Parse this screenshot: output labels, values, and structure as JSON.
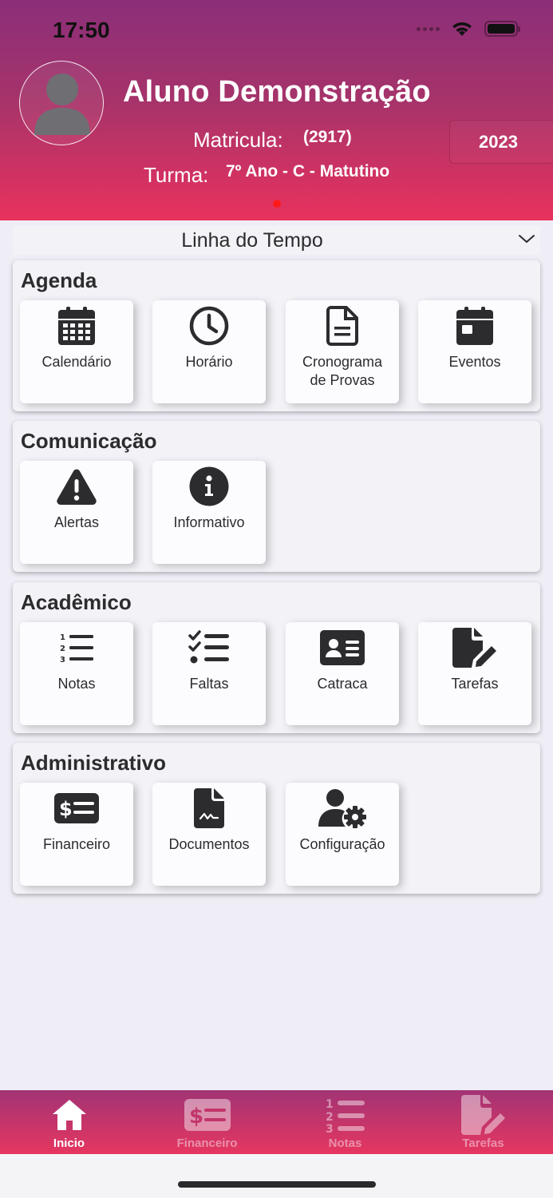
{
  "status_bar": {
    "time": "17:50"
  },
  "profile": {
    "name": "Aluno Demonstração",
    "matricula_label": "Matricula:",
    "matricula_value": "(2917)",
    "turma_label": "Turma:",
    "turma_value": "7º Ano - C - Matutino",
    "year": "2023"
  },
  "timeline": {
    "label": "Linha do Tempo"
  },
  "sections": {
    "agenda": {
      "title": "Agenda",
      "items": [
        {
          "label": "Calendário",
          "icon": "calendar-grid-icon"
        },
        {
          "label": "Horário",
          "icon": "clock-icon"
        },
        {
          "label": "Cronograma\nde Provas",
          "icon": "document-icon"
        },
        {
          "label": "Eventos",
          "icon": "calendar-event-icon"
        }
      ]
    },
    "comunicacao": {
      "title": "Comunicação",
      "items": [
        {
          "label": "Alertas",
          "icon": "warning-icon"
        },
        {
          "label": "Informativo",
          "icon": "info-icon"
        }
      ]
    },
    "academico": {
      "title": "Acadêmico",
      "items": [
        {
          "label": "Notas",
          "icon": "numbered-list-icon"
        },
        {
          "label": "Faltas",
          "icon": "checklist-icon"
        },
        {
          "label": "Catraca",
          "icon": "id-card-icon"
        },
        {
          "label": "Tarefas",
          "icon": "file-edit-icon"
        }
      ]
    },
    "administrativo": {
      "title": "Administrativo",
      "items": [
        {
          "label": "Financeiro",
          "icon": "money-bill-icon"
        },
        {
          "label": "Documentos",
          "icon": "file-signature-icon"
        },
        {
          "label": "Configuração",
          "icon": "user-gear-icon"
        }
      ]
    }
  },
  "tabbar": {
    "items": [
      {
        "label": "Inicio",
        "icon": "home-icon",
        "active": true
      },
      {
        "label": "Financeiro",
        "icon": "money-bill-icon",
        "active": false
      },
      {
        "label": "Notas",
        "icon": "numbered-list-icon",
        "active": false
      },
      {
        "label": "Tarefas",
        "icon": "file-edit-icon",
        "active": false
      }
    ]
  },
  "colors": {
    "header_top": "#8b2f79",
    "header_bottom": "#e8325e",
    "icon": "#2c2c2e",
    "page_dot": "#ff1a1a"
  }
}
